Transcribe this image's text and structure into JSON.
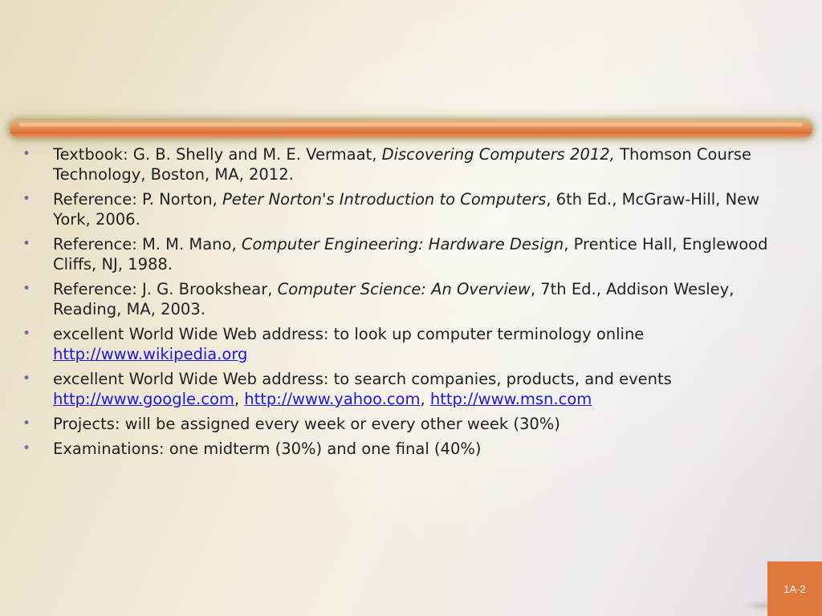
{
  "bullets": [
    {
      "pre": "Textbook: G. B. Shelly and M. E. Vermaat, ",
      "title": "Discovering Computers 2012,",
      "post": " Thomson Course Technology, Boston, MA, 2012."
    },
    {
      "pre": "Reference: P. Norton, ",
      "title": "Peter Norton's Introduction to Computers",
      "post": ", 6th Ed., McGraw-Hill, New York, 2006."
    },
    {
      "pre": "Reference: M. M. Mano, ",
      "title": "Computer Engineering: Hardware Design",
      "post": ", Prentice Hall, Englewood Cliffs, NJ, 1988."
    },
    {
      "pre": "Reference: J. G. Brookshear, ",
      "title": "Computer Science: An Overview",
      "post": ", 7th Ed., Addison Wesley, Reading, MA, 2003."
    },
    {
      "text": "excellent World Wide Web address: to look up computer terminology online",
      "links": [
        "http://www.wikipedia.org"
      ]
    },
    {
      "text": "excellent World Wide Web address: to search companies, products, and events",
      "links": [
        "http://www.google.com",
        "http://www.yahoo.com",
        "http://www.msn.com"
      ],
      "separator": ", "
    },
    {
      "text": "Projects: will be assigned every week or every other week (30%)"
    },
    {
      "text": "Examinations: one midterm (30%) and one final (40%)"
    }
  ],
  "bullet_symbol": "•",
  "slide_number": "1A-2",
  "colors": {
    "accent": "#e0783b",
    "link": "#1a1ad6",
    "bullet": "#6a6fa8"
  }
}
